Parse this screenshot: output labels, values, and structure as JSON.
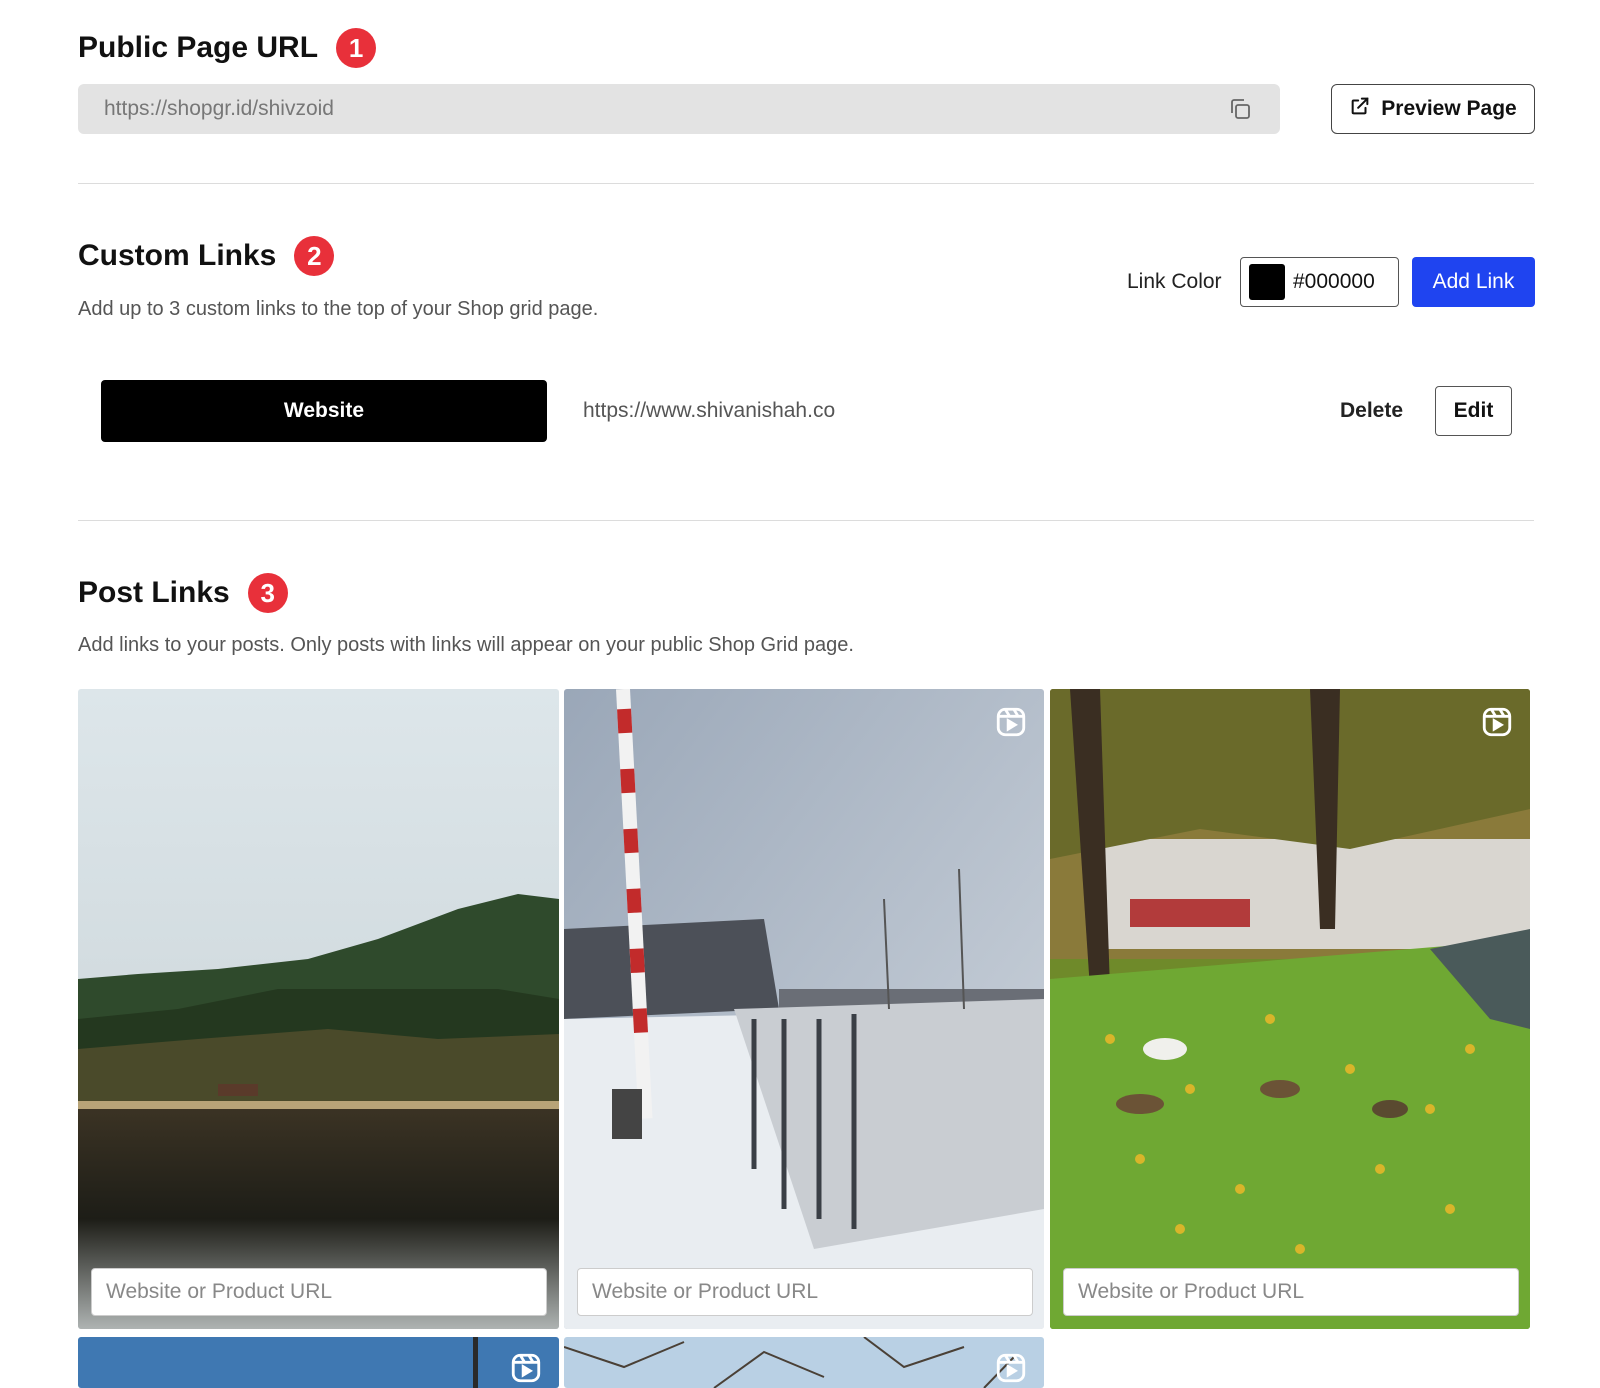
{
  "public_page": {
    "title": "Public Page URL",
    "badge": "1",
    "url": "https://shopgr.id/shivzoid",
    "preview_label": "Preview Page"
  },
  "custom_links": {
    "title": "Custom Links",
    "badge": "2",
    "subtitle": "Add up to 3 custom links to the top of your Shop grid page.",
    "link_color_label": "Link Color",
    "link_color_value": "#000000",
    "add_link_label": "Add Link",
    "links": [
      {
        "label": "Website",
        "url": "https://www.shivanishah.co",
        "delete_label": "Delete",
        "edit_label": "Edit"
      }
    ]
  },
  "post_links": {
    "title": "Post Links",
    "badge": "3",
    "subtitle": "Add links to your posts. Only posts with links will appear on your public Shop Grid page.",
    "input_placeholder": "Website or Product URL"
  },
  "colors": {
    "accent_blue": "#1f44f0",
    "badge_red": "#e8303a"
  }
}
